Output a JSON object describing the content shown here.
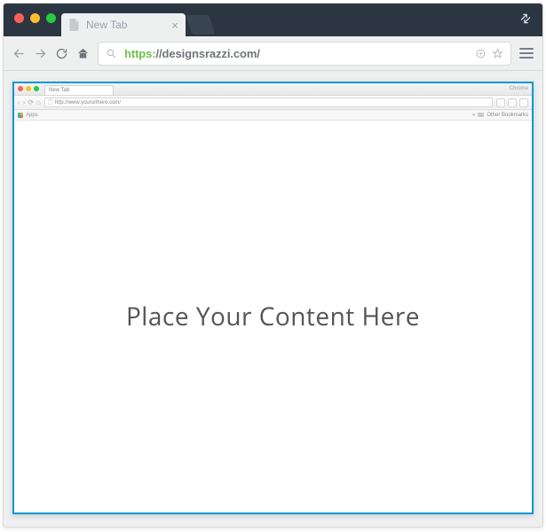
{
  "window": {
    "tab_label": "New Tab",
    "url_protocol": "https:",
    "url_rest": "//designsrazzi.com/"
  },
  "inner": {
    "tab_label": "New Tab",
    "app_name": "Chrome",
    "url": "http://www.yoururlhere.com/",
    "apps_label": "Apps",
    "other_bookmarks_label": "Other Bookmarks",
    "placeholder": "Place Your Content Here"
  }
}
